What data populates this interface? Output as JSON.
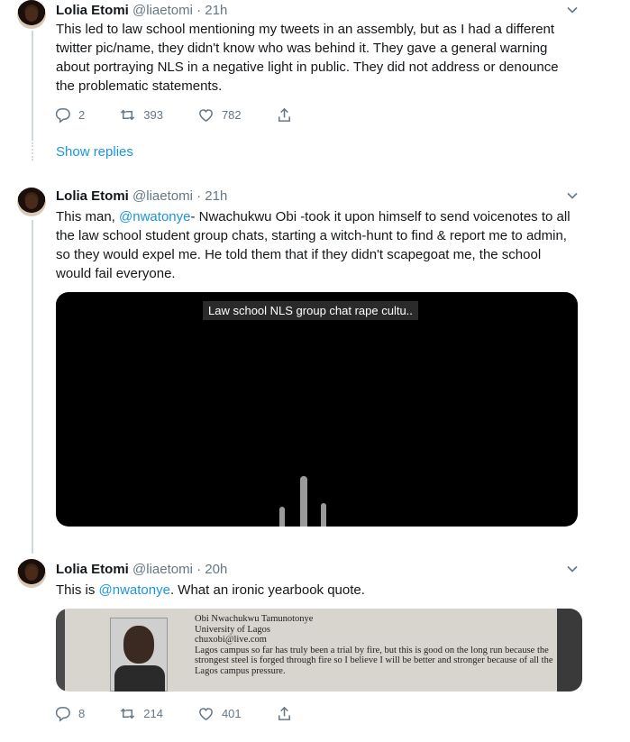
{
  "tweets": [
    {
      "name": "Lolia Etomi",
      "handle": "@liaetomi",
      "dot": "·",
      "time": "21h",
      "text": "This led to law school mentioning my tweets in an assembly, but as I had a different twitter pic/name, they didn't know who was behind it. They gave a general warning about portraying NLS in a negative light in public. They did not address or denounce the problematic statements.",
      "replies": "2",
      "retweets": "393",
      "likes": "782",
      "show_replies": "Show replies"
    },
    {
      "name": "Lolia Etomi",
      "handle": "@liaetomi",
      "dot": "·",
      "time": "21h",
      "text_before": "This man, ",
      "mention": "@nwatonye",
      "text_after": "- Nwachukwu Obi -took it upon himself to send voicenotes to all the law school student group chats, starting a witch-hunt to find & report me to admin, so they would expel me. He told them that if they didn't scapegoat me, the school would fail everyone.",
      "media_caption": "Law school NLS group chat rape cultu.."
    },
    {
      "name": "Lolia Etomi",
      "handle": "@liaetomi",
      "dot": "·",
      "time": "20h",
      "text_before": "This is ",
      "mention": "@nwatonye",
      "text_after": ". What an ironic yearbook quote.",
      "yearbook": {
        "line1": "Obi Nwachukwu Tamunotonye",
        "line2": "University of Lagos",
        "line3": "chuxobi@live.com",
        "line4": "Lagos campus so far has truly been a trial by fire, but this is good on the long run because the strongest steel is forged through fire so I believe I will be better and stronger because of all the Lagos campus pressure."
      },
      "replies": "8",
      "retweets": "214",
      "likes": "401"
    }
  ],
  "colors": {
    "accent": "#1b95e0",
    "muted": "#657786",
    "text": "#14171a"
  },
  "icons": [
    "reply-icon",
    "retweet-icon",
    "like-icon",
    "share-icon",
    "chevron-down-icon"
  ]
}
